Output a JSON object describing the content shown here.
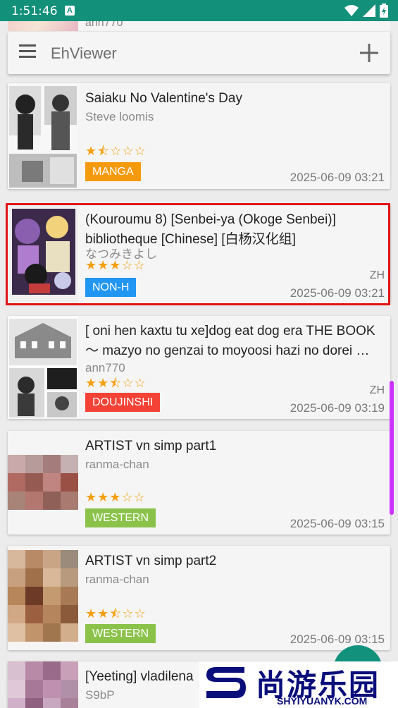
{
  "status_bar": {
    "time": "1:51:46",
    "notification_icon": "A"
  },
  "toolbar": {
    "title": "EhViewer",
    "menu_icon": "menu-icon",
    "add_icon": "plus-icon"
  },
  "partial_top": {
    "uploader": "ann770"
  },
  "galleries": [
    {
      "title": "Saiaku No Valentine's Day",
      "uploader": "Steve loomis",
      "rating": 1.5,
      "stars": "★⯪☆☆☆",
      "category": "MANGA",
      "category_color": "#f59a0c",
      "language": "",
      "posted": "2025-06-09 03:21"
    },
    {
      "title": "(Kouroumu 8) [Senbei-ya (Okoge Senbei)] bibliotheque [Chinese] [白杨汉化组]",
      "uploader": "なつみきよし",
      "rating": 3,
      "stars": "★★★☆☆",
      "category": "NON-H",
      "category_color": "#2196f3",
      "language": "ZH",
      "posted": "2025-06-09 03:21"
    },
    {
      "title": "[ oni hen kaxtu tu xe]dog eat dog era THE BOOK ～ mazyo no genzai to moyoosi hazi no dorei …",
      "uploader": "ann770",
      "rating": 2.5,
      "stars": "★★⯪☆☆",
      "category": "DOUJINSHI",
      "category_color": "#f44336",
      "language": "ZH",
      "posted": "2025-06-09 03:19"
    },
    {
      "title": "ARTIST vn simp part1",
      "uploader": "ranma-chan",
      "rating": 3,
      "stars": "★★★☆☆",
      "category": "WESTERN",
      "category_color": "#8bc34a",
      "language": "",
      "posted": "2025-06-09 03:15"
    },
    {
      "title": "ARTIST vn simp part2",
      "uploader": "ranma-chan",
      "rating": 2.5,
      "stars": "★★⯪☆☆",
      "category": "WESTERN",
      "category_color": "#8bc34a",
      "language": "",
      "posted": "2025-06-09 03:15"
    },
    {
      "title": "[Yeeting] vladilena",
      "uploader": "S9bP"
    }
  ],
  "watermark": {
    "cn": "尚游乐园",
    "en": "SHYIYUANYK.COM"
  },
  "colors": {
    "status_bar": "#13907a",
    "accent": "#12917c",
    "selection": "#e01515",
    "scrollbar": "#cc33ff",
    "star": "#f2a010"
  }
}
